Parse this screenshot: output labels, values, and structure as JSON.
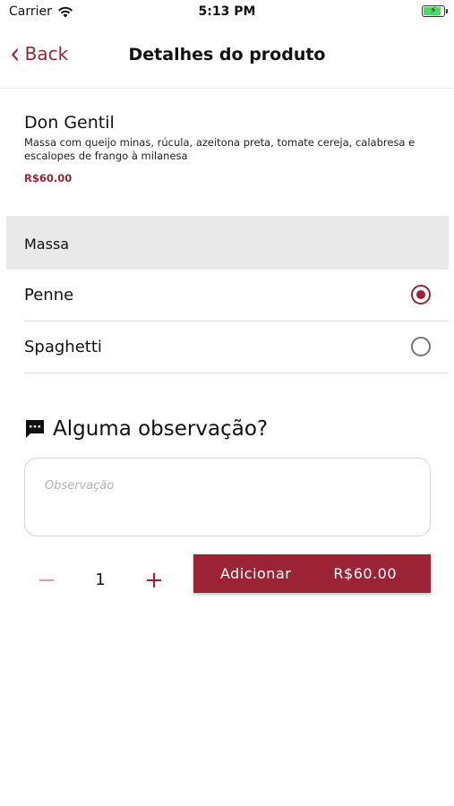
{
  "status_bar": {
    "carrier": "Carrier",
    "time": "5:13 PM"
  },
  "nav": {
    "back_label": "Back",
    "title": "Detalhes do produto"
  },
  "product": {
    "name": "Don Gentil",
    "description": "Massa com queijo minas, rúcula, azeitona preta, tomate cereja, calabresa e escalopes de frango à milanesa",
    "price": "R$60.00"
  },
  "section": {
    "title": "Massa",
    "options": [
      {
        "label": "Penne",
        "selected": true
      },
      {
        "label": "Spaghetti",
        "selected": false
      }
    ]
  },
  "observation": {
    "heading": "Alguma observação?",
    "placeholder": "Observação",
    "value": ""
  },
  "quantity": {
    "minus": "−",
    "value": "1",
    "plus": "+"
  },
  "add_button": {
    "label": "Adicionar",
    "price": "R$60.00"
  },
  "colors": {
    "accent": "#9b2335",
    "section_bg": "#e9e9e9"
  }
}
